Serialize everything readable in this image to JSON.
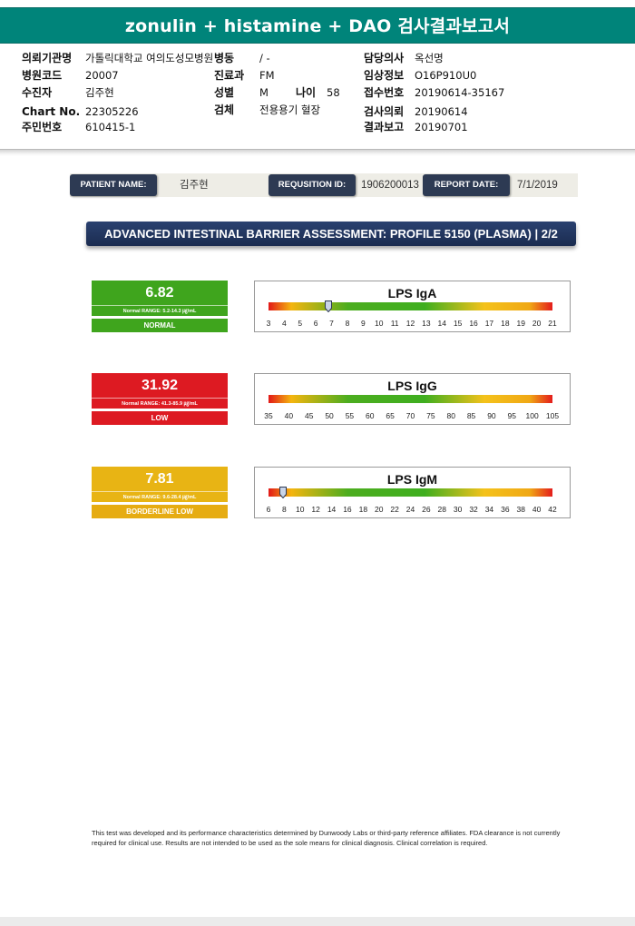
{
  "title": "zonulin + histamine + DAO 검사결과보고서",
  "info": {
    "institution": {
      "label": "의뢰기관명",
      "value": "가톨릭대학교 여의도성모병원"
    },
    "ward": {
      "label": "병동",
      "value": "/ -"
    },
    "doctor": {
      "label": "담당의사",
      "value": "옥선명"
    },
    "hospital_code": {
      "label": "병원코드",
      "value": "20007"
    },
    "department": {
      "label": "진료과",
      "value": "FM"
    },
    "clinical_info": {
      "label": "임상정보",
      "value": "O16P910U0"
    },
    "patient": {
      "label": "수진자",
      "value": "김주현"
    },
    "sex": {
      "label": "성별",
      "value": "M"
    },
    "age": {
      "label": "나이",
      "value": "58"
    },
    "receipt_no": {
      "label": "접수번호",
      "value": "20190614-35167"
    },
    "chart_no": {
      "label": "Chart No.",
      "value": "22305226"
    },
    "specimen": {
      "label": "검체",
      "value": "전용용기 혈장"
    },
    "request_date": {
      "label": "검사의뢰",
      "value": "20190614"
    },
    "resident_no": {
      "label": "주민번호",
      "value": "610415-1"
    },
    "report_date": {
      "label": "결과보고",
      "value": "20190701"
    }
  },
  "patient_strip": {
    "name_label": "PATIENT NAME:",
    "name_value": "김주현",
    "req_label": "REQUSITION ID:",
    "req_value": "1906200013",
    "date_label": "REPORT DATE:",
    "date_value": "7/1/2019"
  },
  "section_title": "ADVANCED INTESTINAL BARRIER ASSESSMENT: PROFILE 5150 (PLASMA) | 2/2",
  "results": [
    {
      "name": "LPS IgA",
      "value": "6.82",
      "value_num": 6.82,
      "range": "Normal RANGE: 5.2-14.3 ㎍/mL",
      "status": "NORMAL",
      "color": "#3fa51d",
      "status_color": "#3fa51d",
      "ticks": [
        "3",
        "4",
        "5",
        "6",
        "7",
        "8",
        "9",
        "10",
        "11",
        "12",
        "13",
        "14",
        "15",
        "16",
        "17",
        "18",
        "19",
        "20",
        "21"
      ],
      "scale_min": 3,
      "scale_max": 21,
      "show_marker": true
    },
    {
      "name": "LPS IgG",
      "value": "31.92",
      "value_num": 31.92,
      "range": "Normal RANGE: 41.3-85.9 ㎍/mL",
      "status": "LOW",
      "color": "#dd1a22",
      "status_color": "#dd1a22",
      "ticks": [
        "35",
        "40",
        "45",
        "50",
        "55",
        "60",
        "65",
        "70",
        "75",
        "80",
        "85",
        "90",
        "95",
        "100",
        "105"
      ],
      "scale_min": 35,
      "scale_max": 105,
      "show_marker": false
    },
    {
      "name": "LPS IgM",
      "value": "7.81",
      "value_num": 7.81,
      "range": "Normal RANGE: 9.6-28.4 ㎍/mL",
      "status": "BORDERLINE LOW",
      "color": "#e8b414",
      "status_color": "#e6ac12",
      "ticks": [
        "6",
        "8",
        "10",
        "12",
        "14",
        "16",
        "18",
        "20",
        "22",
        "24",
        "26",
        "28",
        "30",
        "32",
        "34",
        "36",
        "38",
        "40",
        "42"
      ],
      "scale_min": 6,
      "scale_max": 42,
      "show_marker": true
    }
  ],
  "footer_note": "This test was developed and its performance characteristics determined by Dunwoody Labs or third-party reference affiliates. FDA clearance is not currently required for clinical use. Results are not intended to be used as the sole means for clinical diagnosis. Clinical correlation is required."
}
